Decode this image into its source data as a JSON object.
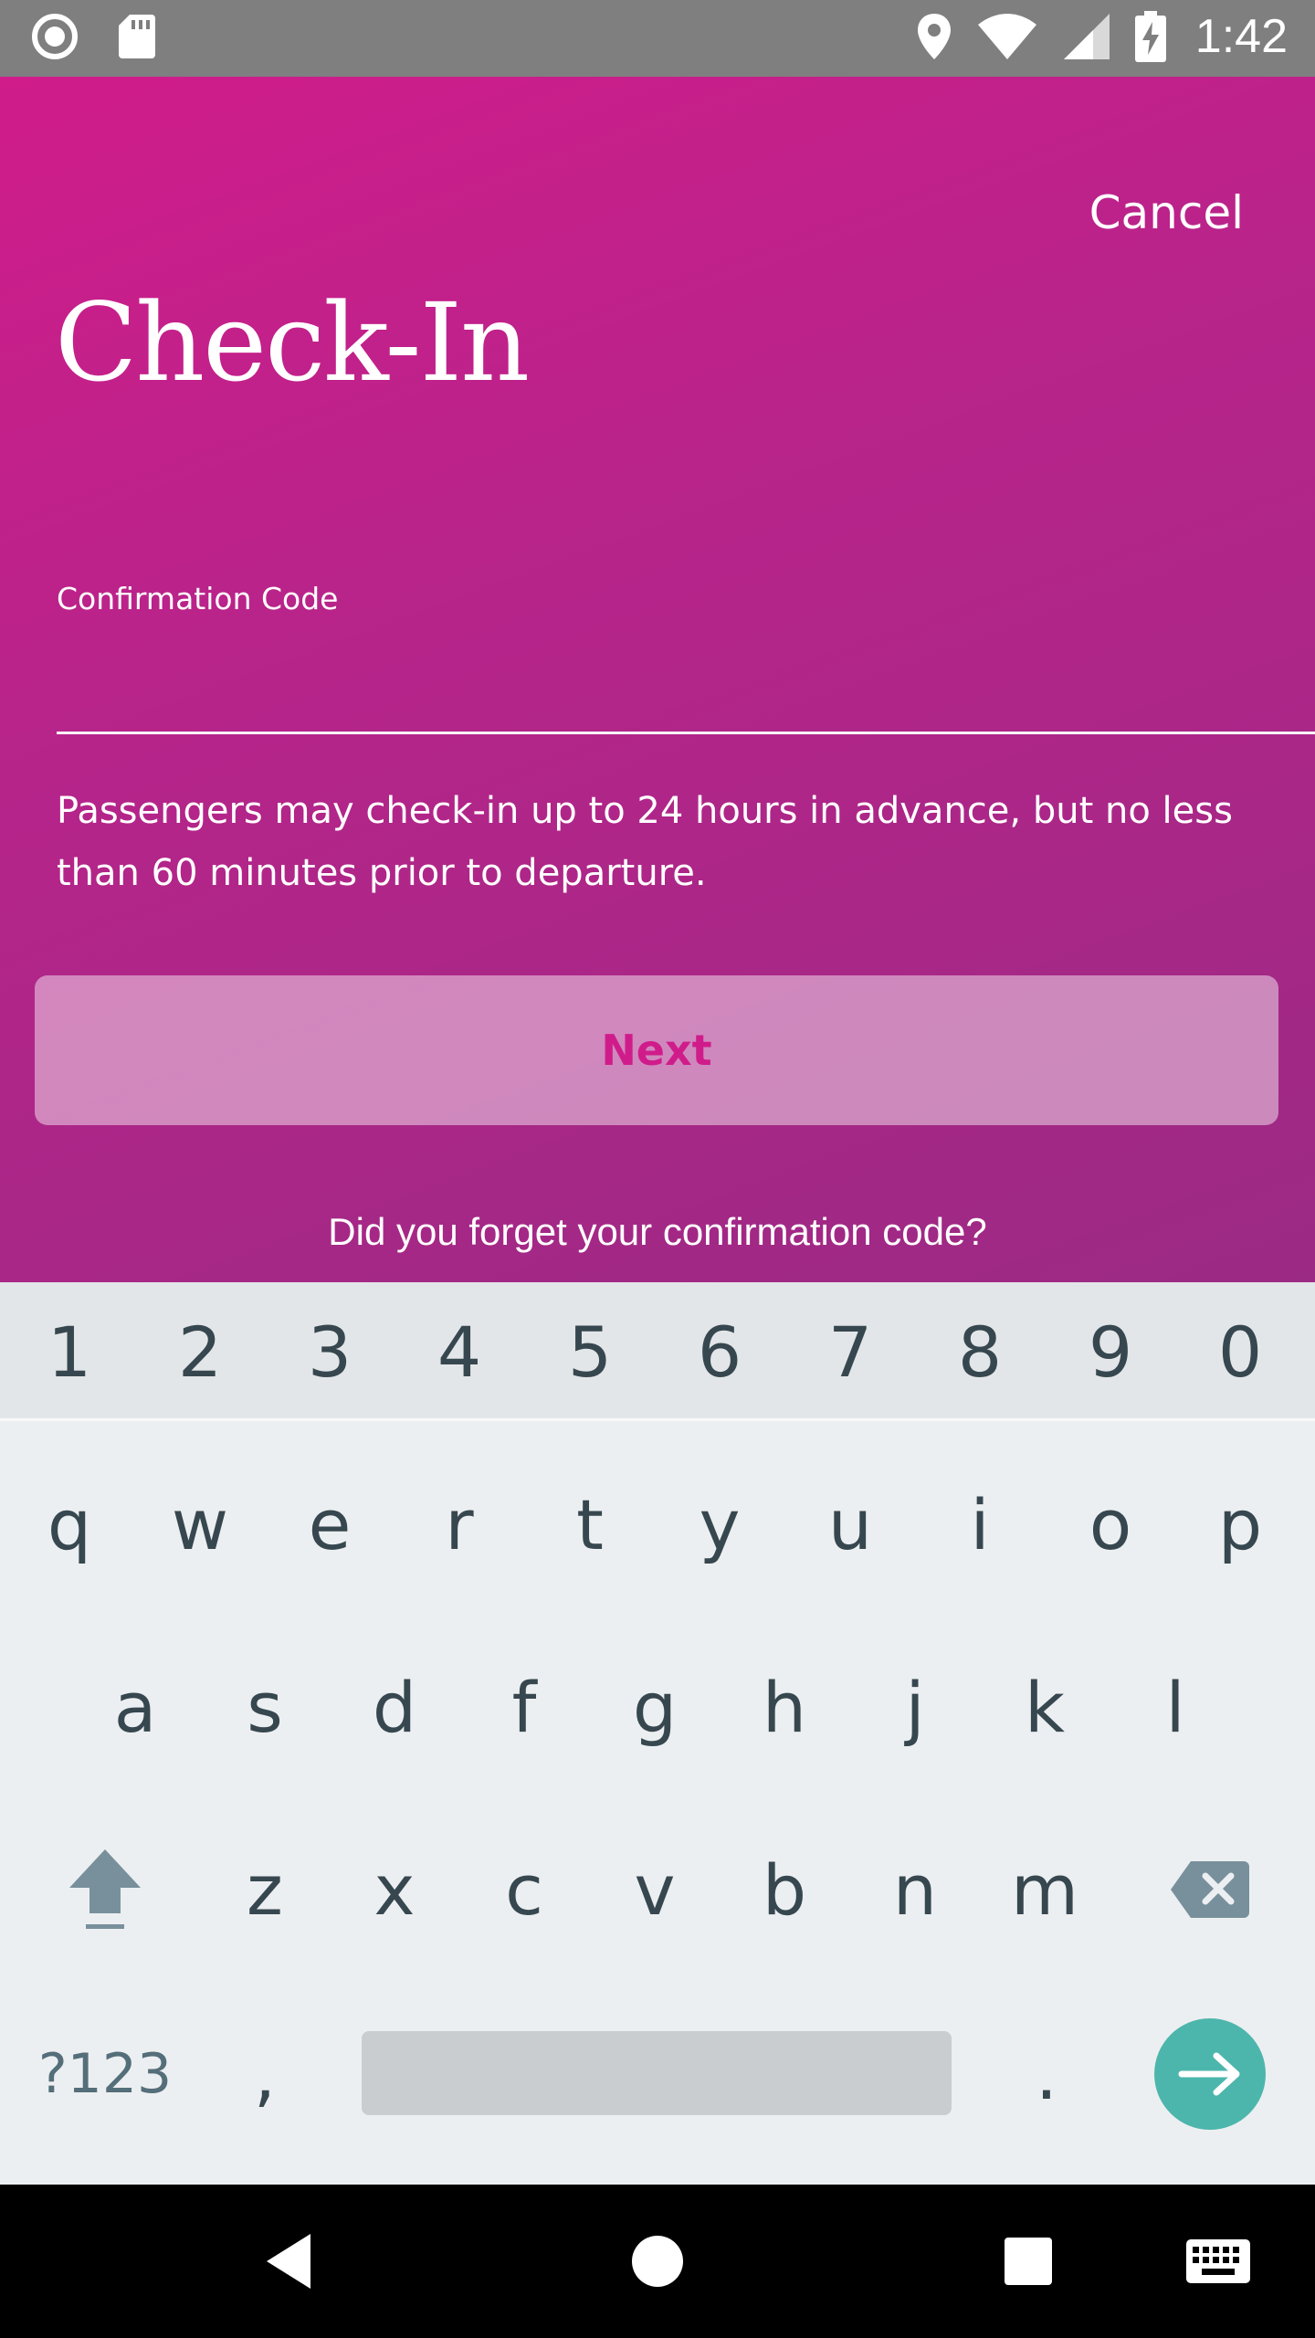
{
  "status_bar": {
    "time": "1:42",
    "icons": [
      "record-icon",
      "sd-card-icon",
      "location-icon",
      "wifi-icon",
      "cell-signal-icon",
      "battery-charging-icon"
    ]
  },
  "header": {
    "cancel_label": "Cancel",
    "title": "Check-In"
  },
  "form": {
    "confirmation_label": "Confirmation Code",
    "confirmation_value": "",
    "info_text": "Passengers may check-in up to 24 hours in advance, but no less than 60 minutes prior to departure.",
    "next_label": "Next",
    "forgot_link": "Did you forget your confirmation code?"
  },
  "colors": {
    "brand_pink": "#d01c8b",
    "keyboard_bg": "#eceff1",
    "enter_key": "#4db6ac"
  },
  "keyboard": {
    "number_row": [
      "1",
      "2",
      "3",
      "4",
      "5",
      "6",
      "7",
      "8",
      "9",
      "0"
    ],
    "row1": [
      "q",
      "w",
      "e",
      "r",
      "t",
      "y",
      "u",
      "i",
      "o",
      "p"
    ],
    "row2": [
      "a",
      "s",
      "d",
      "f",
      "g",
      "h",
      "j",
      "k",
      "l"
    ],
    "row3": [
      "z",
      "x",
      "c",
      "v",
      "b",
      "n",
      "m"
    ],
    "symbols_label": "?123",
    "comma": ",",
    "period": "."
  },
  "nav_bar": {
    "buttons": [
      "back-icon",
      "home-icon",
      "recents-icon",
      "keyboard-icon"
    ]
  }
}
